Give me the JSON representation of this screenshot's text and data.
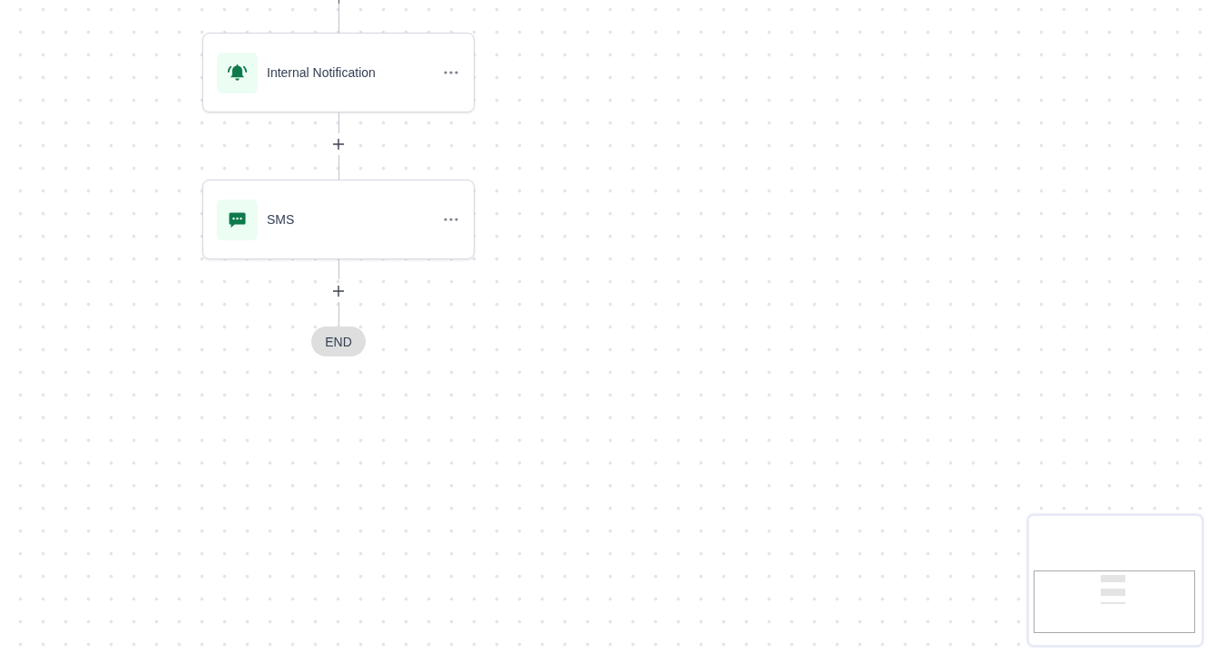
{
  "flow": {
    "steps": [
      {
        "kind": "notification",
        "label": "Internal Notification"
      },
      {
        "kind": "sms",
        "label": "SMS"
      }
    ],
    "end": {
      "label": "END"
    }
  }
}
